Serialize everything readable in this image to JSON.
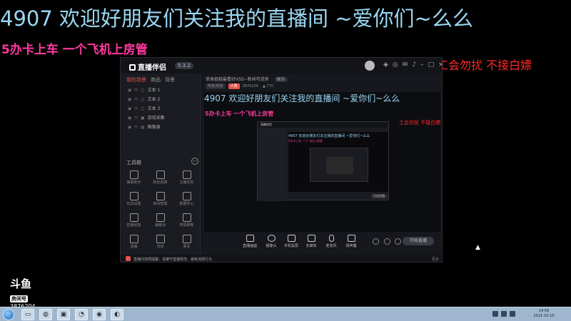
{
  "overlay": {
    "line1": "4907 欢迎好朋友们关注我的直播间 ~爱你们~么么",
    "line2": "5办卡上车 一个飞机上房管",
    "side": "工会勿扰 不接白嫖"
  },
  "app": {
    "name": "直播伴侣",
    "version": "5.3.2",
    "title_icons": [
      "notify-icon",
      "skin-icon",
      "mail-icon",
      "bell-icon",
      "minimize-icon",
      "maximize-icon",
      "close-icon"
    ]
  },
  "sidebar": {
    "tabs": [
      "我的场景",
      "商品",
      "背景"
    ],
    "sources": [
      {
        "label": "文本 1"
      },
      {
        "label": "文本 2"
      },
      {
        "label": "文本 3"
      },
      {
        "label": "游戏采集"
      },
      {
        "label": "图像源"
      }
    ],
    "tools_title": "工具箱",
    "tools_toggle": "—",
    "tools": [
      {
        "label": "弹幕助手",
        "icon": "danmu-icon"
      },
      {
        "label": "粉丝勋章",
        "icon": "fans-icon"
      },
      {
        "label": "主播任务",
        "icon": "task-icon"
      },
      {
        "label": "玩法设置",
        "icon": "play-icon"
      },
      {
        "label": "房间管理",
        "icon": "room-icon"
      },
      {
        "label": "数据中心",
        "icon": "data-icon"
      },
      {
        "label": "直播回放",
        "icon": "replay-icon"
      },
      {
        "label": "弹幕池",
        "icon": "pool-icon"
      },
      {
        "label": "表情推荐",
        "icon": "emoji-icon"
      },
      {
        "label": "直播",
        "icon": "live-icon"
      },
      {
        "label": "活动",
        "icon": "event-icon"
      },
      {
        "label": "更多",
        "icon": "more-icon"
      }
    ]
  },
  "content": {
    "room_title": "单身姐姐最看好VSS~粉丝可进来",
    "room_tag": "娱乐",
    "category": "电竞/网游",
    "live_badge": "人数",
    "room_id": "3876204",
    "heat": "770",
    "preview_line1": "4907 欢迎好朋友们关注我的直播间 ~爱你们~么么",
    "preview_line2": "5办卡上车 一个飞机上房管",
    "preview_side": "工会勿扰 不接白嫖",
    "nested_title": "直播伴侣",
    "nested_line1": "4907 欢迎好朋友们关注我的直播间 ~爱你们~么么",
    "nested_line2": "5办卡上车 一个飞机上房管",
    "nested_go": "开始直播"
  },
  "controls": [
    {
      "label": "直播画面",
      "icon": "screen-icon"
    },
    {
      "label": "摄像头",
      "icon": "camera-icon"
    },
    {
      "label": "手机投屏",
      "icon": "phone-icon"
    },
    {
      "label": "多媒体",
      "icon": "media-icon"
    },
    {
      "label": "麦克风",
      "icon": "mic-icon"
    },
    {
      "label": "扬声器",
      "icon": "speaker-icon"
    }
  ],
  "go_live": "开始直播",
  "notice": {
    "text": "直播间违规提醒：请遵守直播规范，避免违规行为",
    "right": "更多"
  },
  "douyu": {
    "brand": "斗鱼",
    "tag": "房间号",
    "room": "3876204"
  },
  "taskbar": {
    "time": "14:59",
    "date": "2021-10-10"
  }
}
